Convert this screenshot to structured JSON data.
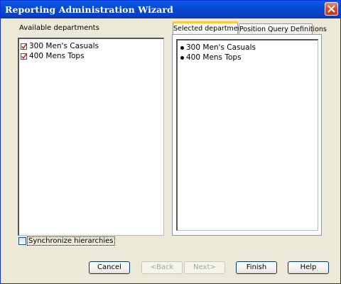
{
  "window": {
    "title": "Reporting Administration Wizard"
  },
  "available": {
    "label": "Available departments",
    "items": [
      {
        "label": "300 Men's Casuals",
        "checked": true
      },
      {
        "label": "400 Mens Tops",
        "checked": true
      }
    ]
  },
  "tabs": [
    {
      "label": "Selected departments",
      "active": true
    },
    {
      "label": "Position Query Definitions",
      "active": false
    }
  ],
  "selected": {
    "items": [
      {
        "label": "300 Men's Casuals"
      },
      {
        "label": "400 Mens Tops"
      }
    ]
  },
  "sync": {
    "label": "Synchronize hierarchies",
    "checked": false
  },
  "buttons": {
    "cancel": "Cancel",
    "back": "<Back",
    "next": "Next>",
    "finish": "Finish",
    "help": "Help"
  },
  "colors": {
    "titlebar": "#0a44c7",
    "dialog_bg": "#ece9d8",
    "check_red": "#c0281c",
    "tab_accent": "#ffc83c"
  }
}
